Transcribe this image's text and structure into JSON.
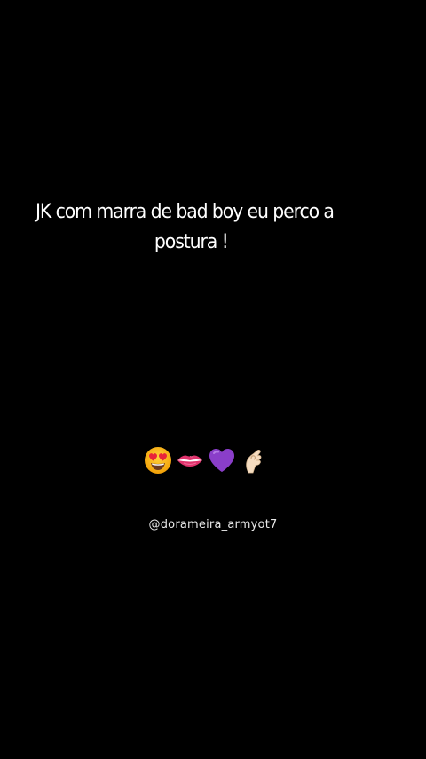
{
  "caption": {
    "line1": "JK com marra de bad boy eu perco a",
    "line2": "postura !"
  },
  "emojis": [
    "heart-eyes-face-icon",
    "lips-icon",
    "purple-heart-icon",
    "pinching-hand-icon"
  ],
  "handle": "@dorameira_armyot7",
  "colors": {
    "background": "#000000",
    "text": "#ffffff"
  }
}
